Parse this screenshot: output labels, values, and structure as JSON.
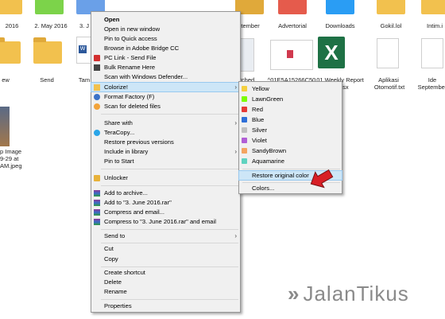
{
  "desktop": {
    "files": [
      {
        "label": "2016"
      },
      {
        "label": "2. May 2016"
      },
      {
        "label": "3. J"
      },
      {
        "label": "ptember"
      },
      {
        "label": "Advertorial"
      },
      {
        "label": "Downloads"
      },
      {
        "label": "Gokil.lol"
      },
      {
        "label": "Intim.i"
      },
      {
        "label": "ew"
      },
      {
        "label": "Send"
      },
      {
        "label": "Tam"
      },
      {
        "label": "tched"
      },
      {
        "label": "^01E5A15266C50"
      },
      {
        "label": "01 Weekly Report"
      },
      {
        "label": "alsx"
      },
      {
        "label": "Aplikasi"
      },
      {
        "label": "Otomotif.txt"
      },
      {
        "label": "Ide September"
      },
      {
        "label": "p Image"
      },
      {
        "label": "9-29 at"
      },
      {
        "label": "AM.jpeg"
      }
    ]
  },
  "context_menu": {
    "items": [
      {
        "label": "Open",
        "bold": true
      },
      {
        "label": "Open in new window"
      },
      {
        "label": "Pin to Quick access"
      },
      {
        "label": "Browse in Adobe Bridge CC"
      },
      {
        "label": "PC Link - Send File"
      },
      {
        "label": "Bulk Rename Here"
      },
      {
        "label": "Scan with Windows Defender..."
      },
      {
        "label": "Colorize!"
      },
      {
        "label": "Format Factory (F)"
      },
      {
        "label": "Scan for deleted files"
      },
      {
        "label": "Share with"
      },
      {
        "label": "TeraCopy..."
      },
      {
        "label": "Restore previous versions"
      },
      {
        "label": "Include in library"
      },
      {
        "label": "Pin to Start"
      },
      {
        "label": "Unlocker"
      },
      {
        "label": "Add to archive..."
      },
      {
        "label": "Add to \"3. June 2016.rar\""
      },
      {
        "label": "Compress and email..."
      },
      {
        "label": "Compress to \"3. June 2016.rar\" and email"
      },
      {
        "label": "Send to"
      },
      {
        "label": "Cut"
      },
      {
        "label": "Copy"
      },
      {
        "label": "Create shortcut"
      },
      {
        "label": "Delete"
      },
      {
        "label": "Rename"
      },
      {
        "label": "Properties"
      }
    ]
  },
  "colorize_submenu": {
    "colors": [
      {
        "label": "Yellow",
        "color": "#f4d03f"
      },
      {
        "label": "LawnGreen",
        "color": "#7cfc00"
      },
      {
        "label": "Red",
        "color": "#e53935"
      },
      {
        "label": "Blue",
        "color": "#2e6fd8"
      },
      {
        "label": "Silver",
        "color": "#c0c0c0"
      },
      {
        "label": "Violet",
        "color": "#b05ed6"
      },
      {
        "label": "SandyBrown",
        "color": "#f4a460"
      },
      {
        "label": "Aquamarine",
        "color": "#5fd3c0"
      }
    ],
    "restore_label": "Restore original color",
    "colors_label": "Colors..."
  },
  "watermark": {
    "text": "JalanTikus"
  },
  "colors": {
    "highlight": "#cde6f7",
    "menu_bg": "#f0f0f0"
  }
}
